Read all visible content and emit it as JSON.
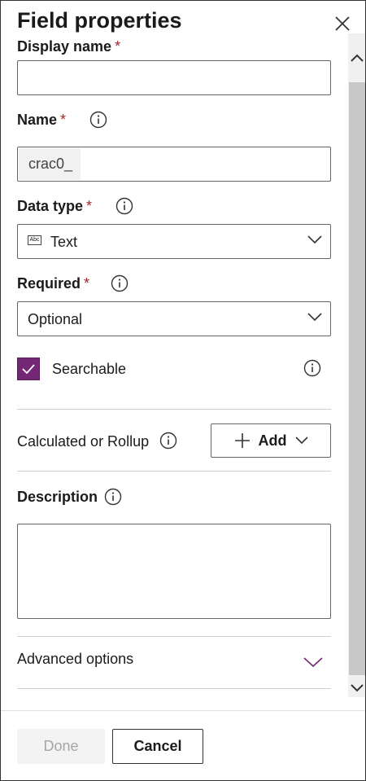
{
  "panel": {
    "title": "Field properties"
  },
  "fields": {
    "display_name": {
      "label": "Display name",
      "required_mark": "*",
      "value": ""
    },
    "name": {
      "label": "Name",
      "required_mark": "*",
      "prefix": "crac0_",
      "value": ""
    },
    "data_type": {
      "label": "Data type",
      "required_mark": "*",
      "icon": "abc-text-icon",
      "icon_text": "Abc",
      "value": "Text"
    },
    "required": {
      "label": "Required",
      "required_mark": "*",
      "value": "Optional"
    },
    "searchable": {
      "label": "Searchable",
      "checked": true
    },
    "calculated": {
      "label": "Calculated or Rollup",
      "add_label": "Add"
    },
    "description": {
      "label": "Description",
      "value": ""
    },
    "advanced": {
      "label": "Advanced options"
    }
  },
  "footer": {
    "done_label": "Done",
    "cancel_label": "Cancel"
  },
  "colors": {
    "accent": "#742774",
    "required": "#a4262c",
    "disabled_bg": "#f3f3f3",
    "disabled_text": "#a6a6a6"
  }
}
